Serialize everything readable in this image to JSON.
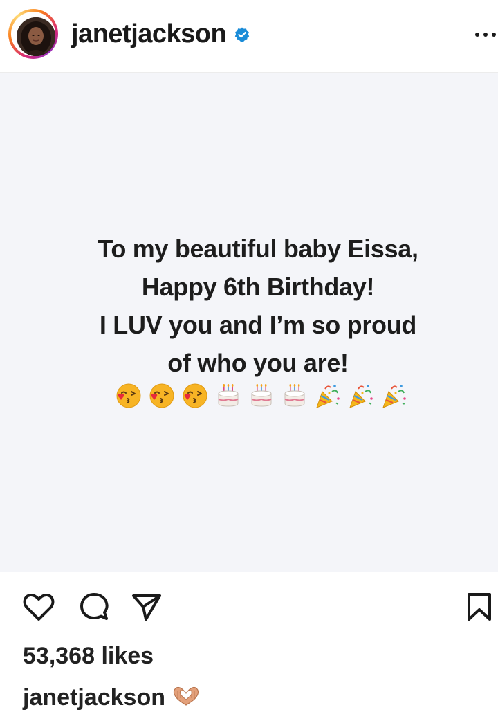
{
  "header": {
    "username": "janetjackson",
    "verified_icon": "verified-badge-icon",
    "more_icon": "more-options-icon"
  },
  "post": {
    "text_lines": [
      "To my beautiful baby Eissa,",
      "Happy 6th Birthday!",
      "I LUV you and I’m so proud",
      "of who you are!"
    ],
    "emojis": [
      "kissing-face-with-heart",
      "kissing-face-with-heart",
      "kissing-face-with-heart",
      "birthday-cake",
      "birthday-cake",
      "birthday-cake",
      "party-popper",
      "party-popper",
      "party-popper"
    ],
    "background_color": "#f4f5f9"
  },
  "actions": {
    "like_icon": "heart-icon",
    "comment_icon": "comment-icon",
    "share_icon": "share-icon",
    "save_icon": "bookmark-icon"
  },
  "likes_text": "53,368 likes",
  "caption": {
    "username": "janetjackson",
    "emoji": "heart-hands"
  },
  "colors": {
    "verified": "#1a8cd8",
    "text": "#1a1a1a"
  }
}
